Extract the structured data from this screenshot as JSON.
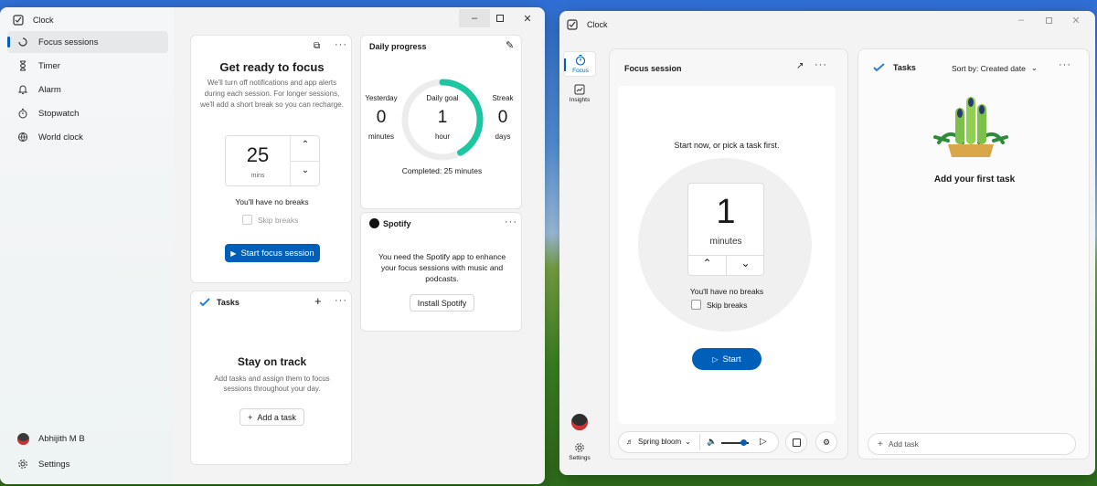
{
  "left_window": {
    "title": "Clock",
    "nav": [
      {
        "label": "Focus sessions",
        "icon": "focus-icon"
      },
      {
        "label": "Timer",
        "icon": "hourglass-icon"
      },
      {
        "label": "Alarm",
        "icon": "bell-icon"
      },
      {
        "label": "Stopwatch",
        "icon": "stopwatch-icon"
      },
      {
        "label": "World clock",
        "icon": "globe-icon"
      }
    ],
    "user": "Abhijith M B",
    "settings": "Settings",
    "focus_card": {
      "title": "Get ready to focus",
      "description": "We'll turn off notifications and app alerts during each session. For longer sessions, we'll add a short break so you can recharge.",
      "minutes": "25",
      "unit": "mins",
      "no_breaks": "You'll have no breaks",
      "skip_breaks": "Skip breaks",
      "start": "Start focus session"
    },
    "progress_card": {
      "title": "Daily progress",
      "yesterday_label": "Yesterday",
      "yesterday_value": "0",
      "yesterday_unit": "minutes",
      "goal_label": "Daily goal",
      "goal_value": "1",
      "goal_unit": "hour",
      "streak_label": "Streak",
      "streak_value": "0",
      "streak_unit": "days",
      "completed": "Completed: 25 minutes",
      "goal_progress": 0.42
    },
    "spotify_card": {
      "title": "Spotify",
      "message": "You need the Spotify app to enhance your focus sessions with music and podcasts.",
      "install": "Install Spotify"
    },
    "tasks_card": {
      "title": "Tasks",
      "heading": "Stay on track",
      "message": "Add tasks and assign them to focus sessions throughout your day.",
      "add": "Add a task"
    }
  },
  "right_window": {
    "title": "Clock",
    "rail": [
      {
        "label": "Focus",
        "icon": "timer-icon"
      },
      {
        "label": "Insights",
        "icon": "chart-icon"
      }
    ],
    "settings": "Settings",
    "focus_panel": {
      "title": "Focus session",
      "prompt": "Start now, or pick a task first.",
      "value": "1",
      "unit": "minutes",
      "no_breaks": "You'll have no breaks",
      "skip_breaks": "Skip breaks",
      "start": "Start"
    },
    "media_bar": {
      "sound": "Spring bloom"
    },
    "tasks_panel": {
      "title": "Tasks",
      "sort": "Sort by: Created date",
      "empty": "Add your first task",
      "add_placeholder": "Add task"
    }
  },
  "colors": {
    "accent": "#005fb8",
    "progress_ring": "#1cc6a0"
  }
}
